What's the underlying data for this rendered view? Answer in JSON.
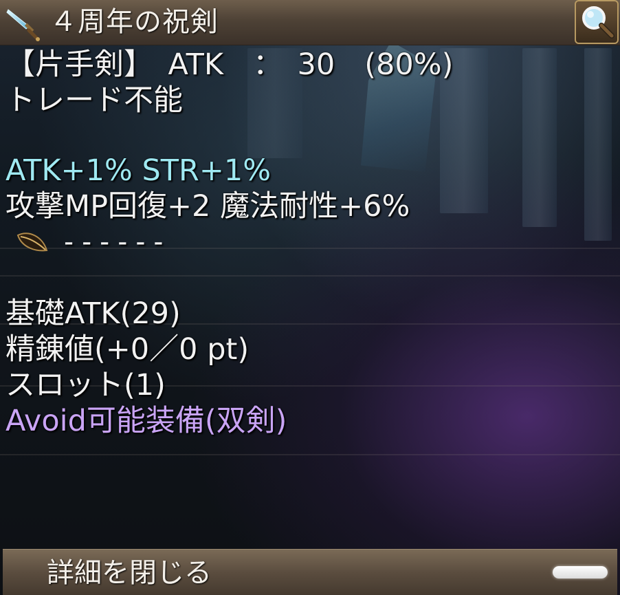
{
  "title_bar": {
    "title": "４周年の祝剣",
    "item_icon": "sword-icon",
    "search_icon": "magnifier-icon"
  },
  "details": {
    "line1": "【片手剣】　ATK　：　30　(80%)",
    "line2": "トレード不能",
    "line3_bonus": "ATK+1% STR+1%",
    "line4_bonus": "攻撃MP回復+2 魔法耐性+6%",
    "slot_icon": "leaf-gem-icon",
    "slot_dashes": "------",
    "base_atk": "基礎ATK(29)",
    "refine": "精錬値(+0／0 pt)",
    "slots": "スロット(1)",
    "avoid": "Avoid可能装備(双剣)"
  },
  "footer": {
    "close_label": "詳細を閉じる"
  },
  "colors": {
    "bonus_text": "#9fe9f2",
    "special_text": "#c9a4f5",
    "panel_brown": "#5b4d3f"
  }
}
